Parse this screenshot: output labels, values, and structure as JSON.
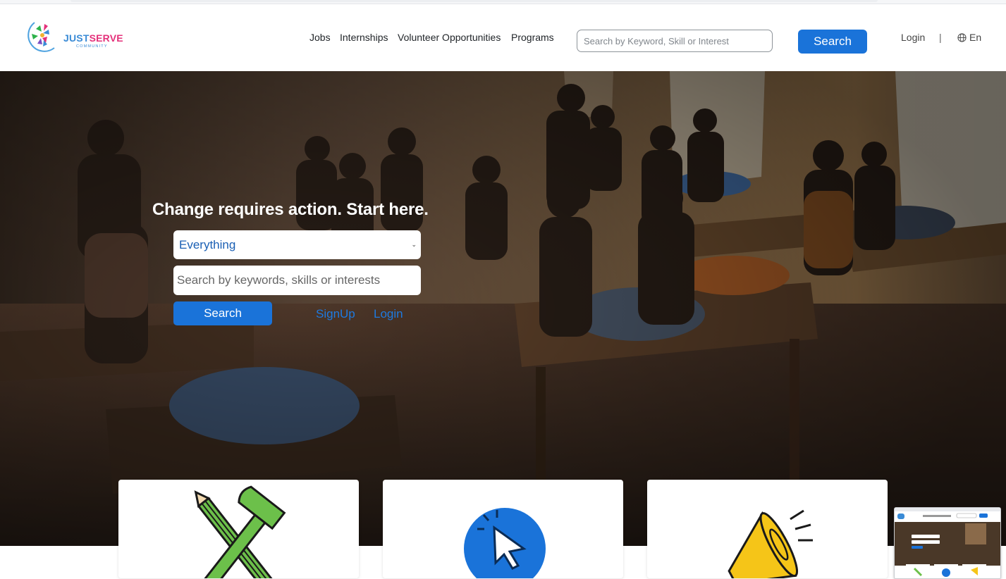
{
  "header": {
    "logo": {
      "name": "JUSTSERVE",
      "name_part1": "JUST",
      "name_part2": "SERVE",
      "sub": "COMMUNITY"
    },
    "nav": [
      "Jobs",
      "Internships",
      "Volunteer Opportunities",
      "Programs"
    ],
    "search_placeholder": "Search by Keyword, Skill or Interest",
    "search_button": "Search",
    "login": "Login",
    "separator": "|",
    "language": "En",
    "language_icon": "globe-icon"
  },
  "hero": {
    "headline": "Change requires action. Start here.",
    "select_value": "Everything",
    "search_placeholder": "Search by keywords, skills or interests",
    "search_button": "Search",
    "signup_link": "SignUp",
    "login_link": "Login"
  },
  "cards": [
    {
      "icon": "hammer-pencil-icon"
    },
    {
      "icon": "cursor-click-icon"
    },
    {
      "icon": "megaphone-icon"
    }
  ],
  "colors": {
    "primary": "#1a73d9",
    "link": "#1e7ae0",
    "logo_blue": "#3a8bd6",
    "logo_pink": "#e4307a"
  }
}
